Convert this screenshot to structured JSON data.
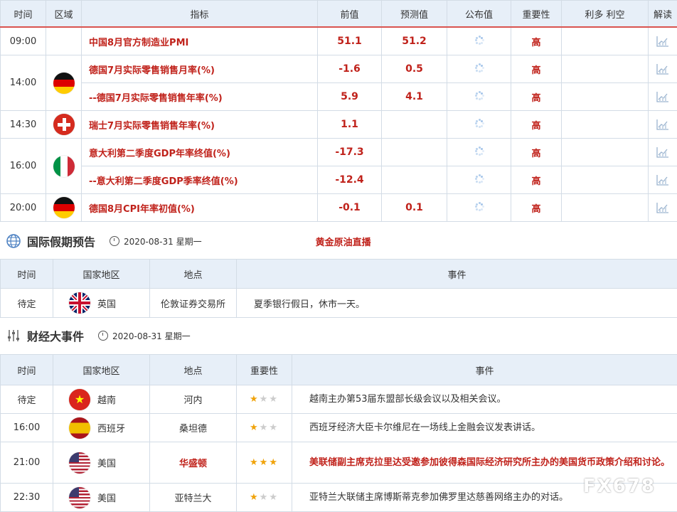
{
  "econ": {
    "headers": [
      "时间",
      "区域",
      "指标",
      "前值",
      "预测值",
      "公布值",
      "重要性",
      "利多 利空",
      "解读"
    ],
    "rows": [
      {
        "time": "09:00",
        "flag": "",
        "name": "中国8月官方制造业PMI",
        "prev": "51.1",
        "forecast": "51.2",
        "importance": "高"
      },
      {
        "time": "14:00",
        "flag": "de",
        "name": "德国7月实际零售销售月率(%)",
        "prev": "-1.6",
        "forecast": "0.5",
        "importance": "高"
      },
      {
        "time": "",
        "flag": "",
        "name": "--德国7月实际零售销售年率(%)",
        "prev": "5.9",
        "forecast": "4.1",
        "importance": "高"
      },
      {
        "time": "14:30",
        "flag": "ch",
        "name": "瑞士7月实际零售销售年率(%)",
        "prev": "1.1",
        "forecast": "",
        "importance": "高"
      },
      {
        "time": "16:00",
        "flag": "it",
        "name": "意大利第二季度GDP年率终值(%)",
        "prev": "-17.3",
        "forecast": "",
        "importance": "高"
      },
      {
        "time": "",
        "flag": "",
        "name": "--意大利第二季度GDP季率终值(%)",
        "prev": "-12.4",
        "forecast": "",
        "importance": "高"
      },
      {
        "time": "20:00",
        "flag": "de",
        "name": "德国8月CPI年率初值(%)",
        "prev": "-0.1",
        "forecast": "0.1",
        "importance": "高"
      }
    ]
  },
  "holiday": {
    "title": "国际假期预告",
    "date": "2020-08-31 星期一",
    "link": "黄金原油直播",
    "headers": [
      "时间",
      "国家地区",
      "地点",
      "事件"
    ],
    "rows": [
      {
        "time": "待定",
        "country": "英国",
        "flag": "uk",
        "place": "伦敦证券交易所",
        "event": "夏季银行假日，休市一天。"
      }
    ]
  },
  "events": {
    "title": "财经大事件",
    "date": "2020-08-31 星期一",
    "headers": [
      "时间",
      "国家地区",
      "地点",
      "重要性",
      "事件"
    ],
    "rows": [
      {
        "time": "待定",
        "country": "越南",
        "flag": "vn",
        "place": "河内",
        "stars": 1,
        "event": "越南主办第53届东盟部长级会议以及相关会议。"
      },
      {
        "time": "16:00",
        "country": "西班牙",
        "flag": "es",
        "place": "桑坦德",
        "stars": 1,
        "event": "西班牙经济大臣卡尔维尼在一场线上金融会议发表讲话。"
      },
      {
        "time": "21:00",
        "country": "美国",
        "flag": "us",
        "place": "华盛顿",
        "stars": 3,
        "event": "美联储副主席克拉里达受邀参加彼得森国际经济研究所主办的美国货币政策介绍和讨论。"
      },
      {
        "time": "22:30",
        "country": "美国",
        "flag": "us",
        "place": "亚特兰大",
        "stars": 1,
        "event": "亚特兰大联储主席博斯蒂克参加佛罗里达慈善网络主办的对话。"
      }
    ]
  },
  "watermark": "FX678"
}
